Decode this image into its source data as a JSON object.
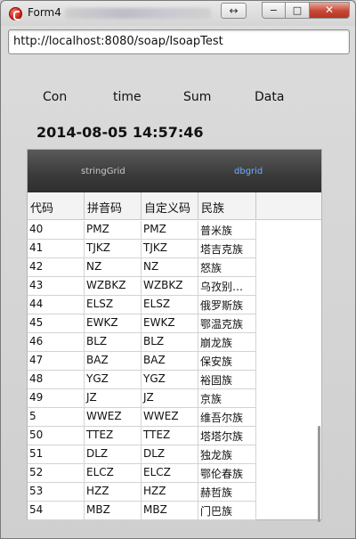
{
  "window": {
    "title": "Form4",
    "swap_icon": "↔",
    "min_icon": "−",
    "max_icon": "□",
    "close_icon": "✕"
  },
  "url": {
    "value": "http://localhost:8080/soap/IsoapTest"
  },
  "labels": {
    "con": "Con",
    "time": "time",
    "sum": "Sum",
    "data": "Data",
    "datetime": "2014-08-05 14:57:46"
  },
  "tabs": {
    "string_grid": "stringGrid",
    "db_grid": "dbgrid"
  },
  "grid": {
    "headers": [
      "代码",
      "拼音码",
      "自定义码",
      "民族"
    ],
    "rows": [
      [
        "40",
        "PMZ",
        "PMZ",
        "普米族"
      ],
      [
        "41",
        "TJKZ",
        "TJKZ",
        "塔吉克族"
      ],
      [
        "42",
        "NZ",
        "NZ",
        "怒族"
      ],
      [
        "43",
        "WZBKZ",
        "WZBKZ",
        "乌孜别…"
      ],
      [
        "44",
        "ELSZ",
        "ELSZ",
        "俄罗斯族"
      ],
      [
        "45",
        "EWKZ",
        "EWKZ",
        "鄂温克族"
      ],
      [
        "46",
        "BLZ",
        "BLZ",
        "崩龙族"
      ],
      [
        "47",
        "BAZ",
        "BAZ",
        "保安族"
      ],
      [
        "48",
        "YGZ",
        "YGZ",
        "裕固族"
      ],
      [
        "49",
        "JZ",
        "JZ",
        "京族"
      ],
      [
        "5",
        "WWEZ",
        "WWEZ",
        "维吾尔族"
      ],
      [
        "50",
        "TTEZ",
        "TTEZ",
        "塔塔尔族"
      ],
      [
        "51",
        "DLZ",
        "DLZ",
        "独龙族"
      ],
      [
        "52",
        "ELCZ",
        "ELCZ",
        "鄂伦春族"
      ],
      [
        "53",
        "HZZ",
        "HZZ",
        "赫哲族"
      ],
      [
        "54",
        "MBZ",
        "MBZ",
        "门巴族"
      ]
    ]
  },
  "colors": {
    "tab_active": "#6ab0ff",
    "tab_inactive": "#c8c8c8",
    "close_button": "#c74735"
  }
}
